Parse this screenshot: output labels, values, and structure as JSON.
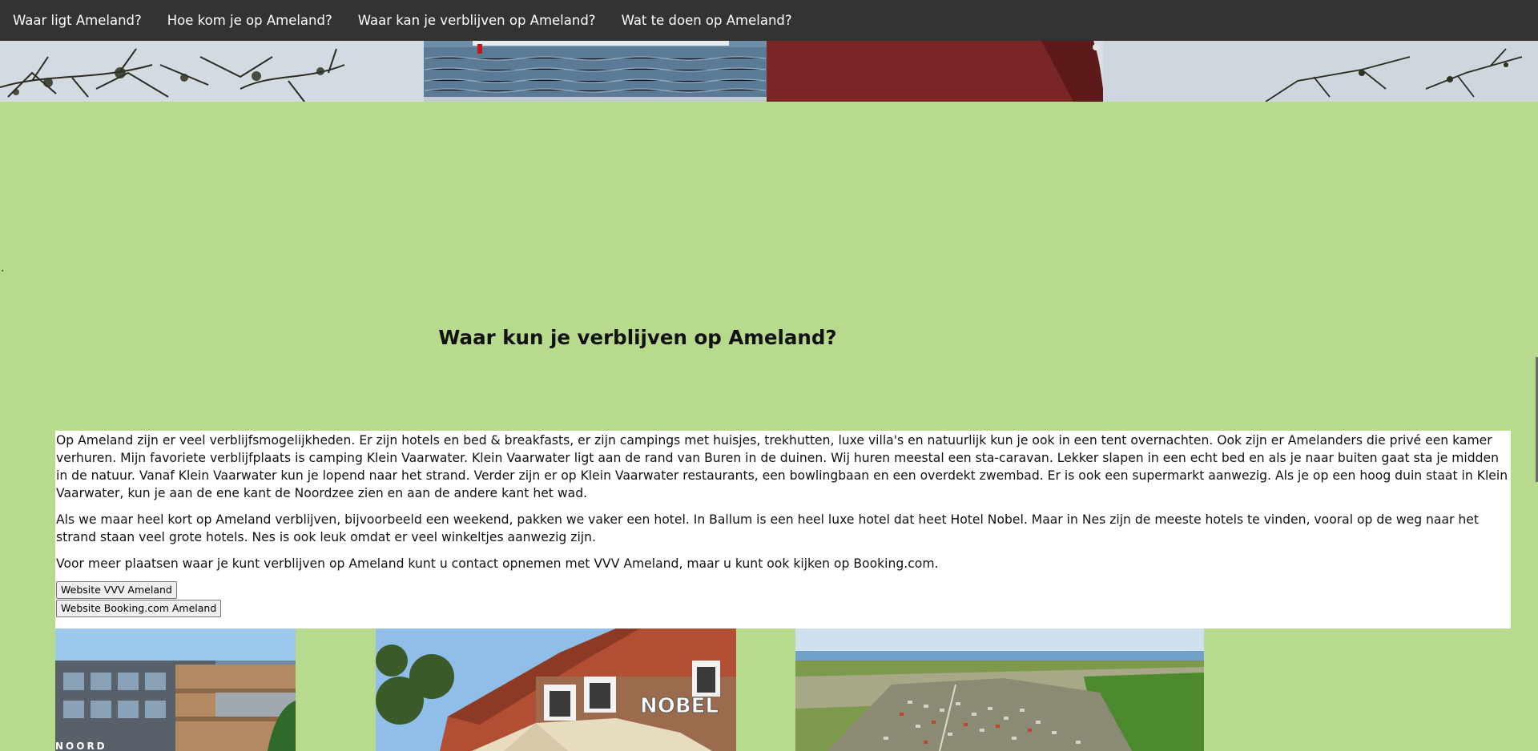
{
  "nav": {
    "items": [
      {
        "label": "Waar ligt Ameland?"
      },
      {
        "label": "Hoe kom je op Ameland?"
      },
      {
        "label": "Waar kan je verblijven op Ameland?"
      },
      {
        "label": "Wat te doen op Ameland?"
      }
    ]
  },
  "stray_dot": ".",
  "section": {
    "title": "Waar kun je verblijven op Ameland?",
    "paragraphs": [
      "Op Ameland zijn er veel verblijfsmogelijkheden. Er zijn hotels en bed & breakfasts, er zijn campings met huisjes, trekhutten, luxe villa's en natuurlijk kun je ook in een tent overnachten. Ook zijn er Amelanders die privé een kamer verhuren. Mijn favoriete verblijfplaats is camping Klein Vaarwater. Klein Vaarwater ligt aan de rand van Buren in de duinen. Wij huren meestal een sta-caravan. Lekker slapen in een echt bed en als je naar buiten gaat sta je midden in de natuur. Vanaf Klein Vaarwater kun je lopend naar het strand. Verder zijn er op Klein Vaarwater restaurants, een bowlingbaan en een overdekt zwembad. Er is ook een supermarkt aanwezig. Als je op een hoog duin staat in Klein Vaarwater, kun je aan de ene kant de Noordzee zien en aan de andere kant het wad.",
      "Als we maar heel kort op Ameland verblijven, bijvoorbeeld een weekend, pakken we vaker een hotel. In Ballum is een heel luxe hotel dat heet Hotel Nobel. Maar in Nes zijn de meeste hotels te vinden, vooral op de weg naar het strand staan veel grote hotels. Nes is ook leuk omdat er veel winkeltjes aanwezig zijn.",
      "Voor meer plaatsen waar je kunt verblijven op Ameland kunt u contact opnemen met VVV Ameland, maar u kunt ook kijken op Booking.com."
    ],
    "buttons": {
      "vvv": "Website VVV Ameland",
      "booking": "Website Booking.com Ameland"
    }
  },
  "photos": {
    "hotel_sign": "NOORD",
    "nobel_sign": "NOBEL"
  },
  "colors": {
    "page_background": "#b8da8c",
    "nav_background": "#333333",
    "content_background": "#ffffff"
  }
}
